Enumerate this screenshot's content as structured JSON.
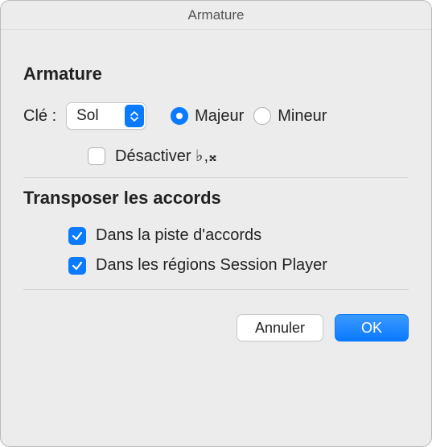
{
  "window": {
    "title": "Armature"
  },
  "armature": {
    "section": "Armature",
    "key_label": "Clé :",
    "key_value": "Sol",
    "major_label": "Majeur",
    "minor_label": "Mineur",
    "mode_selected": "major",
    "disable_label": "Désactiver ",
    "disable_symbol": "♭,𝄪",
    "disable_checked": false
  },
  "transpose": {
    "section": "Transposer les accords",
    "chord_track_label": "Dans la piste d'accords",
    "chord_track_checked": true,
    "session_player_label": "Dans les régions Session Player",
    "session_player_checked": true
  },
  "buttons": {
    "cancel": "Annuler",
    "ok": "OK"
  }
}
